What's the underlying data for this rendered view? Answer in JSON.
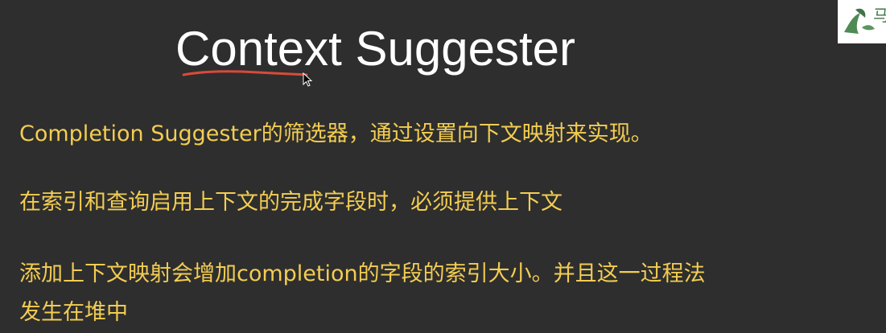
{
  "slide": {
    "title": "Context Suggester",
    "bullets": [
      "Completion Suggester的筛选器，通过设置向下文映射来实现。",
      "在索引和查询启用上下文的完成字段时，必须提供上下文",
      "添加上下文映射会增加completion的字段的索引大小。并且这一过程法",
      "发生在堆中"
    ]
  },
  "colors": {
    "background": "#2e2e2e",
    "title": "#ffffff",
    "bullet_text": "#f3cd52",
    "annotation": "#d94a3a"
  },
  "icons": [
    "mouse-cursor-icon",
    "watermark-logo-icon"
  ]
}
